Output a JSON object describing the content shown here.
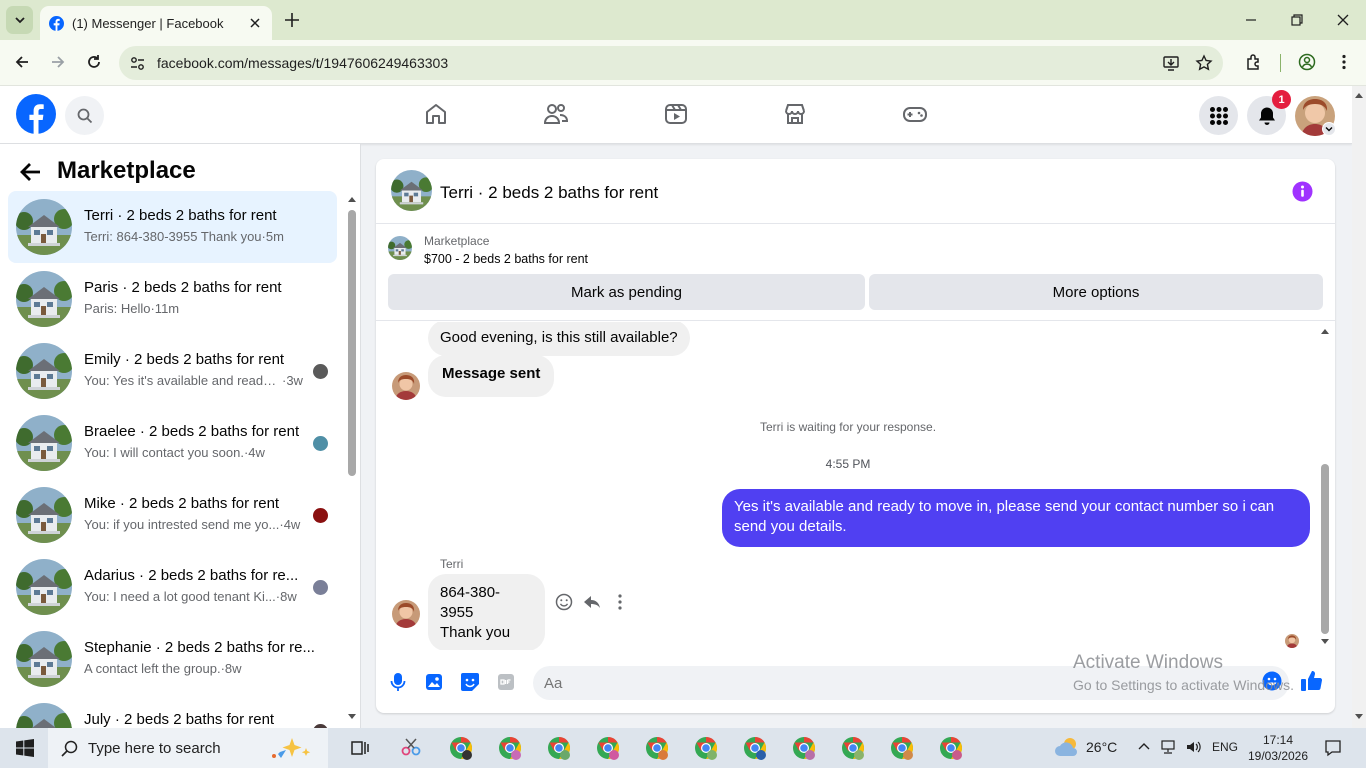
{
  "browser": {
    "tab_title": "(1) Messenger | Facebook",
    "url": "facebook.com/messages/t/1947606249463303"
  },
  "header": {
    "notification_count": "1"
  },
  "left_panel": {
    "title": "Marketplace",
    "conversations": [
      {
        "name": "Terri · 2 beds 2 baths for rent",
        "message": "Terri: 864-380-3955 Thank you",
        "time": "·5m",
        "active": true
      },
      {
        "name": "Paris · 2 beds 2 baths for rent",
        "message": "Paris: Hello",
        "time": "·11m",
        "active": false
      },
      {
        "name": "Emily · 2 beds 2 baths for rent",
        "message": "You: Yes it's available and ready ...",
        "time": "·3w",
        "active": false
      },
      {
        "name": "Braelee · 2 beds 2 baths for rent",
        "message": "You: I will contact you soon.",
        "time": "·4w",
        "active": false
      },
      {
        "name": "Mike · 2 beds 2 baths for rent",
        "message": "You: if you intrested send me yo...",
        "time": "·4w",
        "active": false
      },
      {
        "name": "Adarius · 2 beds 2 baths for re...",
        "message": "You: I need a lot good tenant Ki...",
        "time": "·8w",
        "active": false
      },
      {
        "name": "Stephanie · 2 beds 2 baths for re...",
        "message": "A contact left the group.",
        "time": "·8w",
        "active": false
      },
      {
        "name": "July · 2 beds 2 baths for rent",
        "message": "",
        "time": "",
        "active": false
      }
    ]
  },
  "chat": {
    "title": "Terri · 2 beds 2 baths for rent",
    "marketplace_label": "Marketplace",
    "listing": "$700 - 2 beds 2 baths for rent",
    "mark_pending": "Mark as pending",
    "more_options": "More options",
    "messages": {
      "incoming_1": "Good evening, is this still available?",
      "outgoing_auto": "Message sent",
      "waiting_notice": "Terri is waiting for your response.",
      "timestamp": "4:55 PM",
      "outgoing_main": "Yes it's available and ready to move in, please send your contact number so i can send you details.",
      "sender_name": "Terri",
      "incoming_2_line1": "864-380-3955",
      "incoming_2_line2": "Thank you"
    },
    "composer_placeholder": "Aa"
  },
  "watermark": {
    "line1": "Activate Windows",
    "line2": "Go to Settings to activate Windows."
  },
  "taskbar": {
    "search_placeholder": "Type here to search",
    "temperature": "26°C",
    "language": "ENG",
    "time": "17:14",
    "date": "19/03/2026"
  },
  "colors": {
    "fb_blue": "#0866ff",
    "outgoing_bubble": "#5040f2",
    "active_item": "#e7f3ff",
    "badge_red": "#e41e3f",
    "info_purple": "#a033ff"
  }
}
